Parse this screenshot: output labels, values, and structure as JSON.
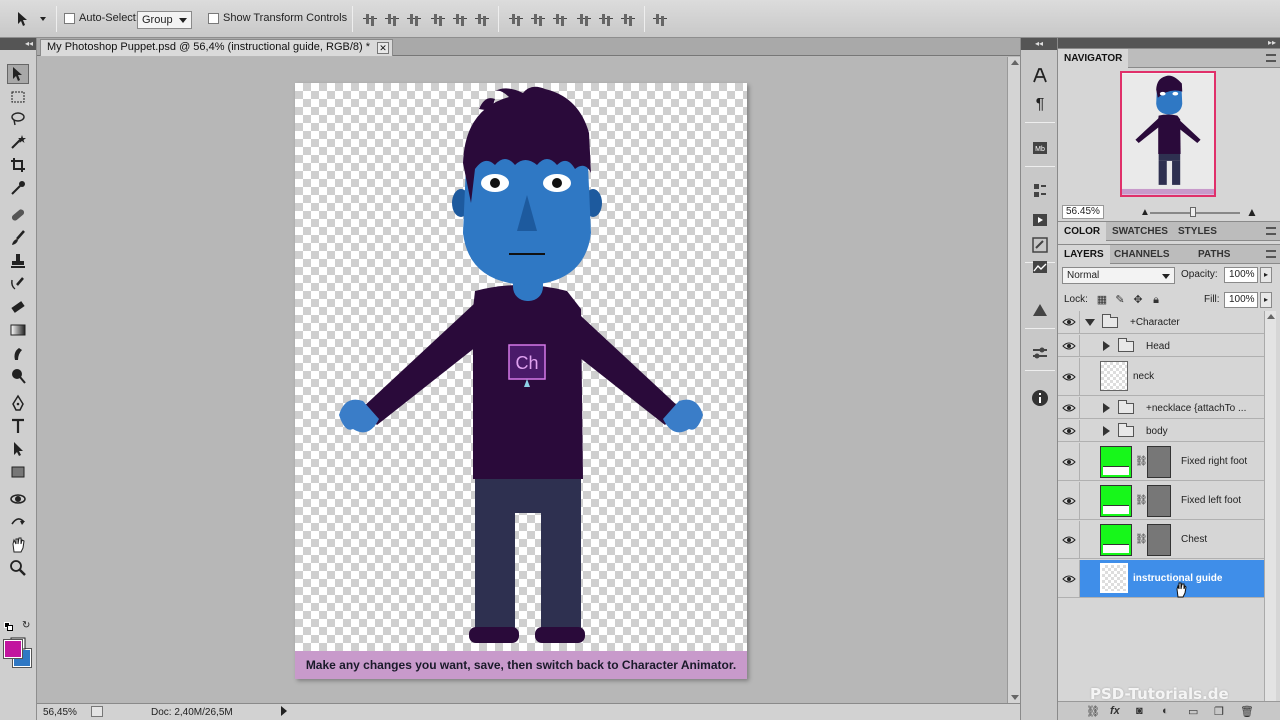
{
  "options_bar": {
    "auto_select_label": "Auto-Select:",
    "auto_select_value": "Group",
    "show_transform_label": "Show Transform Controls"
  },
  "document": {
    "tab_title": "My Photoshop Puppet.psd @ 56,4% (instructional guide, RGB/8) *",
    "close_glyph": "✕",
    "caption": "Make any changes you want, save, then switch back to Character Animator.",
    "shirt_logo": "Ch"
  },
  "status_bar": {
    "zoom": "56,45%",
    "doc_size": "Doc: 2,40M/26,5M"
  },
  "colors": {
    "foreground": "#c2159f",
    "background": "#2f78c4",
    "skin": "#2f78c4",
    "hair_shirt": "#2a0a3a",
    "pants": "#2e3050",
    "caption_bg": "#c89acb",
    "selection": "#3f8ee9",
    "layer_green": "#17f71a"
  },
  "navigator": {
    "tab_navigator": "NAVIGATOR",
    "zoom": "56.45%"
  },
  "color_panel": {
    "tabs": [
      "COLOR",
      "SWATCHES",
      "STYLES"
    ]
  },
  "layers_panel": {
    "tabs": [
      "LAYERS",
      "CHANNELS",
      "PATHS"
    ],
    "blend_mode": "Normal",
    "opacity_label": "Opacity:",
    "opacity": "100%",
    "lock_label": "Lock:",
    "fill_label": "Fill:",
    "fill": "100%",
    "layers": [
      {
        "name": "+Character"
      },
      {
        "name": "Head"
      },
      {
        "name": "neck"
      },
      {
        "name": "+necklace {attachTo ..."
      },
      {
        "name": "body"
      },
      {
        "name": "Fixed right foot"
      },
      {
        "name": "Fixed left foot"
      },
      {
        "name": "Chest"
      },
      {
        "name": "instructional guide"
      }
    ]
  },
  "watermark": "PSD-Tutorials.de"
}
